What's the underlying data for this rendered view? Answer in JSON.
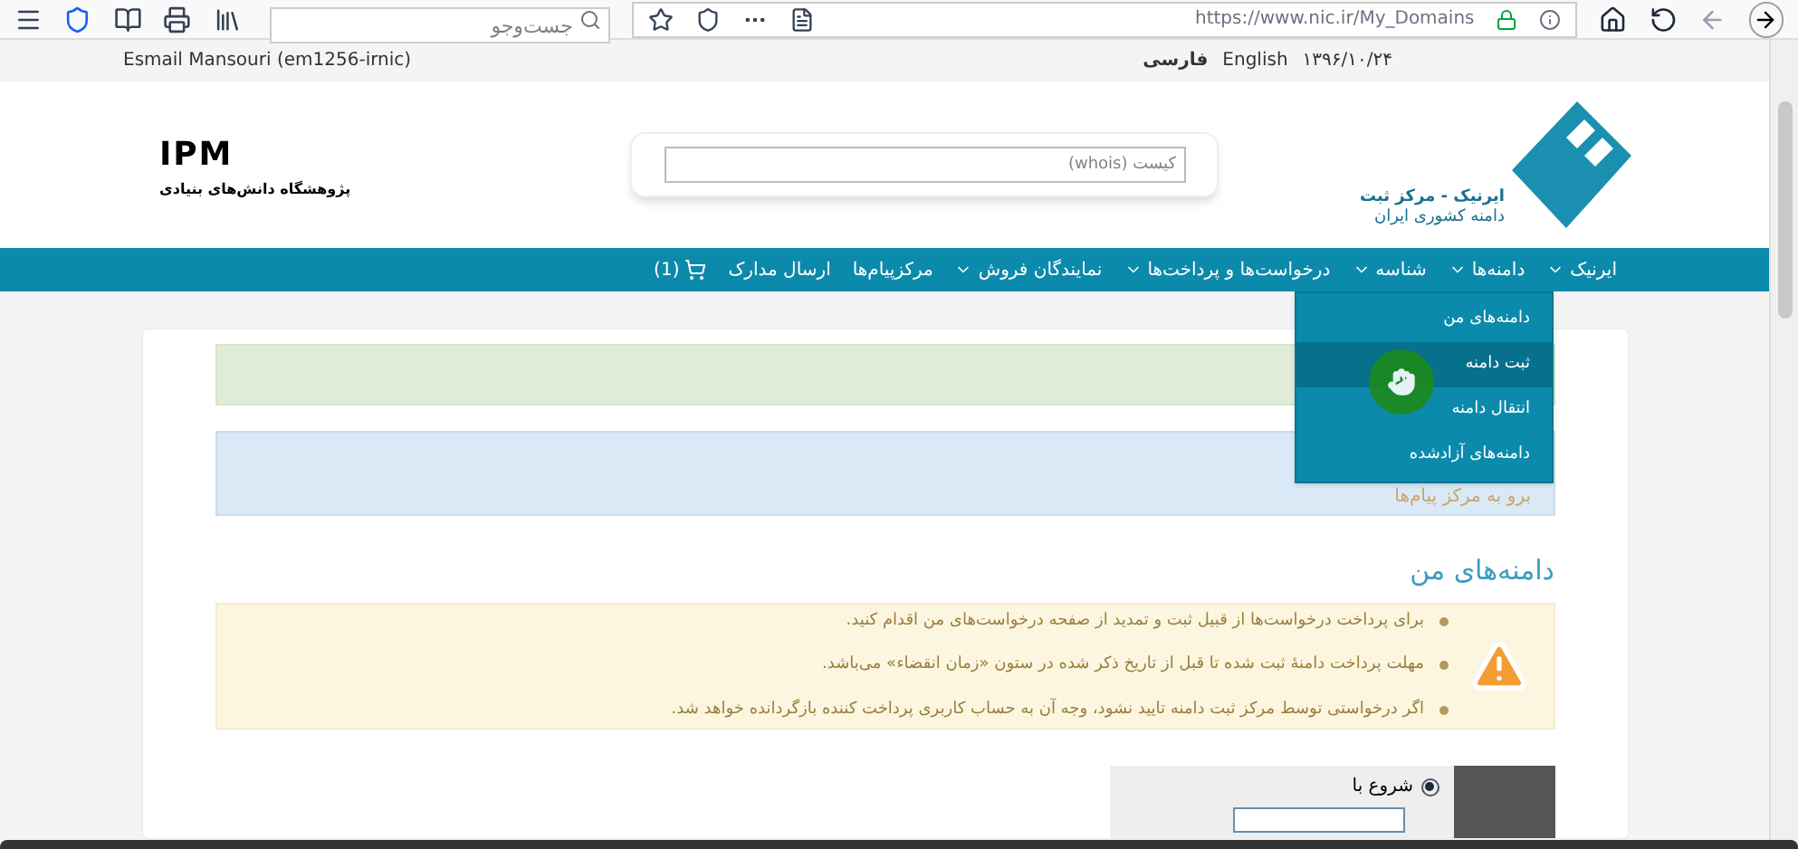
{
  "browser": {
    "search_placeholder": "جست‌وجو",
    "url": "https://www.nic.ir/My_Domains"
  },
  "topbar": {
    "user": "Esmail Mansouri (em1256-irnic)",
    "date": "۱۳۹۶/۱۰/۲۴",
    "languages": [
      {
        "label": "English",
        "selected": false
      },
      {
        "label": "فارسی",
        "selected": true
      }
    ]
  },
  "header": {
    "logo_title": "ایرنیک - مرکز ثبت",
    "logo_subtitle": "دامنه کشوری ایران",
    "whois_placeholder": "کیست (whois)",
    "ipm_logo": "IPM",
    "ipm_subtitle": "پژوهشگاه دانش‌های بنیادی"
  },
  "nav": [
    {
      "label": "ایرنیک",
      "caret": true
    },
    {
      "label": "دامنه‌ها",
      "caret": true
    },
    {
      "label": "شناسه",
      "caret": true
    },
    {
      "label": "درخواست‌ها و پرداخت‌ها",
      "caret": true
    },
    {
      "label": "نمایندگان فروش",
      "caret": true
    },
    {
      "label": "مرکزپیام‌ها",
      "caret": false
    },
    {
      "label": "ارسال مدارک",
      "caret": false
    },
    {
      "label": "(1)",
      "caret": false,
      "kind": "cart"
    }
  ],
  "dropdown": [
    {
      "label": "دامنه‌های من",
      "selected": false
    },
    {
      "label": "ثبت دامنه",
      "selected": true
    },
    {
      "label": "انتقال دامنه",
      "selected": false
    },
    {
      "label": "دامنه‌های آزادشده",
      "selected": false
    }
  ],
  "info_link": "برو به مرکز پیام‌ها",
  "section_title": "دامنه‌های من",
  "warnings": [
    "برای پرداخت درخواست‌ها از قبیل ثبت و تمدید از صفحه درخواست‌های من اقدام کنید.",
    "مهلت پرداخت دامنهٔ ثبت شده تا قبل از تاریخ ذکر شده در ستون «زمان انقضاء» می‌باشد.",
    "اگر درخواستی توسط مرکز ثبت دامنه تایید نشود، وجه آن به حساب کاربری پرداخت کننده بازگردانده خواهد شد."
  ],
  "filter": {
    "option": "شروع با",
    "selected": true
  }
}
